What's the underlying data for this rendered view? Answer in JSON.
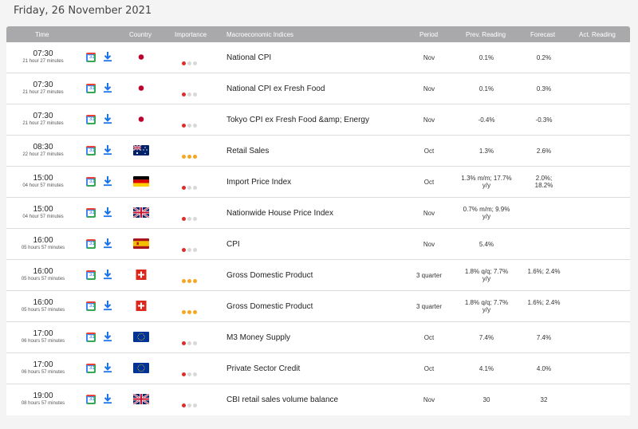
{
  "date_title": "Friday, 26 November 2021",
  "columns": {
    "time": "Time",
    "country": "Country",
    "importance": "Importance",
    "indicator": "Macroeconomic Indices",
    "period": "Period",
    "prev": "Prev. Reading",
    "forecast": "Forecast",
    "actual": "Act. Reading"
  },
  "calendar_icon_day": "31",
  "rows": [
    {
      "time": "07:30",
      "countdown": "21 hour 27 minutes",
      "country": "japan",
      "importance": 1,
      "indicator": "National CPI",
      "period": "Nov",
      "prev": "0.1%",
      "forecast": "0.2%",
      "actual": ""
    },
    {
      "time": "07:30",
      "countdown": "21 hour 27 minutes",
      "country": "japan",
      "importance": 1,
      "indicator": "National CPI ex Fresh Food",
      "period": "Nov",
      "prev": "0.1%",
      "forecast": "0.3%",
      "actual": ""
    },
    {
      "time": "07:30",
      "countdown": "21 hour 27 minutes",
      "country": "japan",
      "importance": 1,
      "indicator": "Tokyo CPI ex Fresh Food &amp; Energy",
      "period": "Nov",
      "prev": "-0.4%",
      "forecast": "-0.3%",
      "actual": ""
    },
    {
      "time": "08:30",
      "countdown": "22 hour 27 minutes",
      "country": "australia",
      "importance": 3,
      "indicator": "Retail Sales",
      "period": "Oct",
      "prev": "1.3%",
      "forecast": "2.6%",
      "actual": ""
    },
    {
      "time": "15:00",
      "countdown": "04 hour 57 minutes",
      "country": "germany",
      "importance": 1,
      "indicator": "Import Price Index",
      "period": "Oct",
      "prev": "1.3% m/m; 17.7% y/y",
      "forecast": "2.0%; 18.2%",
      "actual": ""
    },
    {
      "time": "15:00",
      "countdown": "04 hour 57 minutes",
      "country": "uk",
      "importance": 1,
      "indicator": "Nationwide House Price Index",
      "period": "Nov",
      "prev": "0.7% m/m; 9.9% y/y",
      "forecast": "",
      "actual": ""
    },
    {
      "time": "16:00",
      "countdown": "05 hours 57 minutes",
      "country": "spain",
      "importance": 1,
      "indicator": "CPI",
      "period": "Nov",
      "prev": "5.4%",
      "forecast": "",
      "actual": ""
    },
    {
      "time": "16:00",
      "countdown": "05 hours 57 minutes",
      "country": "switzerland",
      "importance": 3,
      "indicator": "Gross Domestic Product",
      "period": "3 quarter",
      "prev": "1.8% q/q; 7.7% y/y",
      "forecast": "1.6%; 2.4%",
      "actual": ""
    },
    {
      "time": "16:00",
      "countdown": "05 hours 57 minutes",
      "country": "switzerland",
      "importance": 3,
      "indicator": "Gross Domestic Product",
      "period": "3 quarter",
      "prev": "1.8% q/q; 7.7% y/y",
      "forecast": "1.6%; 2.4%",
      "actual": ""
    },
    {
      "time": "17:00",
      "countdown": "06 hours 57 minutes",
      "country": "eu",
      "importance": 1,
      "indicator": "M3 Money Supply",
      "period": "Oct",
      "prev": "7.4%",
      "forecast": "7.4%",
      "actual": ""
    },
    {
      "time": "17:00",
      "countdown": "06 hours 57 minutes",
      "country": "eu",
      "importance": 1,
      "indicator": "Private Sector Credit",
      "period": "Oct",
      "prev": "4.1%",
      "forecast": "4.0%",
      "actual": ""
    },
    {
      "time": "19:00",
      "countdown": "08 hours 57 minutes",
      "country": "uk",
      "importance": 1,
      "indicator": "CBI retail sales volume balance",
      "period": "Nov",
      "prev": "30",
      "forecast": "32",
      "actual": ""
    }
  ]
}
